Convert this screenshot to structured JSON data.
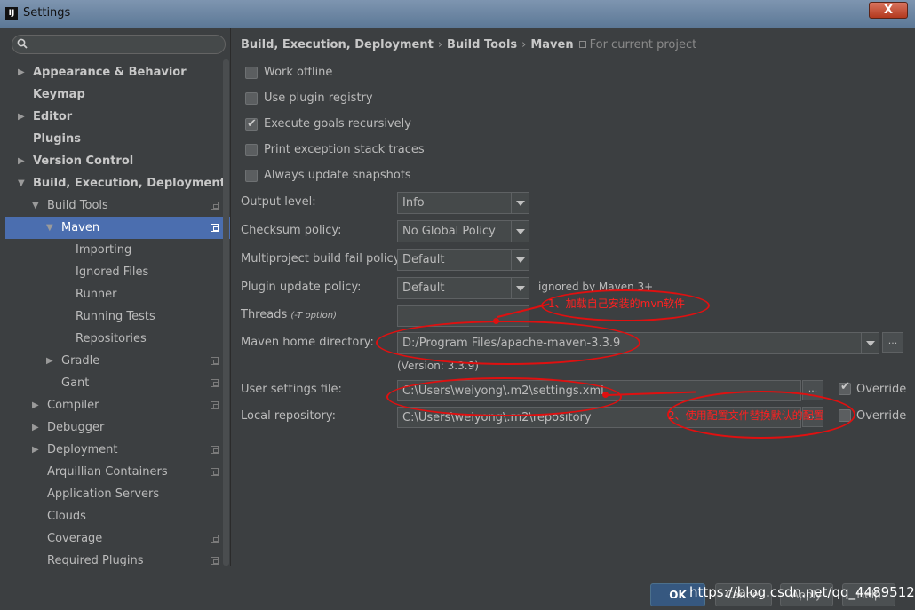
{
  "window": {
    "title": "Settings",
    "app_icon": "IJ",
    "close_label": "X"
  },
  "search": {
    "placeholder": ""
  },
  "tree": [
    {
      "label": "Appearance & Behavior",
      "arrow": "▶",
      "bold": true
    },
    {
      "label": "Keymap",
      "arrow": "",
      "bold": true
    },
    {
      "label": "Editor",
      "arrow": "▶",
      "bold": true
    },
    {
      "label": "Plugins",
      "arrow": "",
      "bold": true
    },
    {
      "label": "Version Control",
      "arrow": "▶",
      "bold": true
    },
    {
      "label": "Build, Execution, Deployment",
      "arrow": "▼",
      "bold": true
    },
    {
      "label": "Build Tools",
      "arrow": "▼",
      "project_icon": true
    },
    {
      "label": "Maven",
      "arrow": "▼",
      "project_icon": true,
      "selected": true
    },
    {
      "label": "Importing"
    },
    {
      "label": "Ignored Files"
    },
    {
      "label": "Runner"
    },
    {
      "label": "Running Tests"
    },
    {
      "label": "Repositories"
    },
    {
      "label": "Gradle",
      "arrow": "▶",
      "project_icon": true
    },
    {
      "label": "Gant",
      "project_icon": true
    },
    {
      "label": "Compiler",
      "arrow": "▶",
      "project_icon": true
    },
    {
      "label": "Debugger",
      "arrow": "▶"
    },
    {
      "label": "Deployment",
      "arrow": "▶",
      "project_icon": true
    },
    {
      "label": "Arquillian Containers",
      "project_icon": true
    },
    {
      "label": "Application Servers"
    },
    {
      "label": "Clouds"
    },
    {
      "label": "Coverage",
      "project_icon": true
    },
    {
      "label": "Required Plugins",
      "project_icon": true
    }
  ],
  "breadcrumb": {
    "items": [
      "Build, Execution, Deployment",
      "Build Tools",
      "Maven"
    ],
    "separator": "›",
    "scope": "For current project"
  },
  "checkboxes": [
    {
      "label": "Work offline",
      "checked": false
    },
    {
      "label": "Use plugin registry",
      "checked": false
    },
    {
      "label": "Execute goals recursively",
      "checked": true
    },
    {
      "label": "Print exception stack traces",
      "checked": false
    },
    {
      "label": "Always update snapshots",
      "checked": false
    }
  ],
  "fields": {
    "output_level": {
      "label": "Output level:",
      "value": "Info"
    },
    "checksum_policy": {
      "label": "Checksum policy:",
      "value": "No Global Policy"
    },
    "multiproject_fail_policy": {
      "label": "Multiproject build fail policy:",
      "value": "Default"
    },
    "plugin_update_policy": {
      "label": "Plugin update policy:",
      "value": "Default",
      "note": "ignored by Maven 3+"
    },
    "threads": {
      "label": "Threads",
      "hint": "(-T option)",
      "value": ""
    },
    "maven_home": {
      "label": "Maven home directory:",
      "value": "D:/Program Files/apache-maven-3.3.9",
      "version": "(Version: 3.3.9)",
      "browse": "..."
    },
    "user_settings": {
      "label": "User settings file:",
      "value": "C:\\Users\\weiyong\\.m2\\settings.xml",
      "override_label": "Override",
      "override_checked": true,
      "browse": "..."
    },
    "local_repository": {
      "label": "Local repository:",
      "value": "C:\\Users\\weiyong\\.m2\\repository",
      "override_label": "Override",
      "override_checked": false,
      "browse": "..."
    }
  },
  "annotations": {
    "note1": "1、加载自己安装的mvn软件",
    "note2": "2、使用配置文件替换默认的配置",
    "color": "#e01010"
  },
  "footer": {
    "ok": "OK",
    "cancel": "Cancel",
    "apply": "Apply",
    "help": "Help"
  },
  "watermark": "https://blog.csdn.net/qq_44895127"
}
